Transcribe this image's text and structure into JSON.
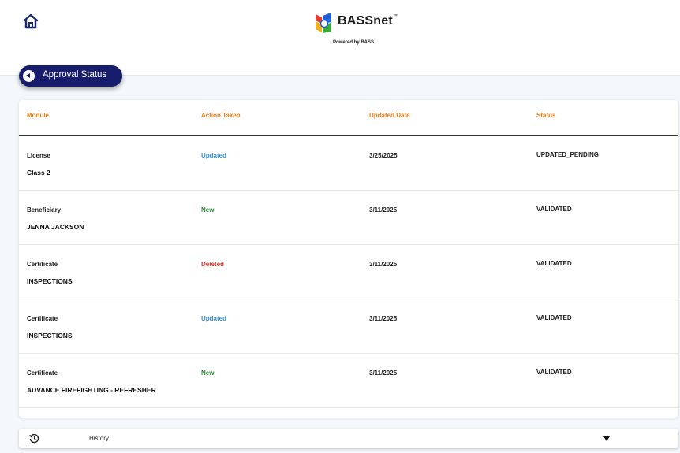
{
  "header": {
    "brand_name": "BASSnet",
    "brand_trademark": "™",
    "brand_tagline": "Powered by BASS",
    "home_icon": "home-icon"
  },
  "page": {
    "back_icon": "back-arrow-icon",
    "title": "Approval Status"
  },
  "table": {
    "columns": [
      "Module",
      "Action Taken",
      "Updated Date",
      "Status"
    ],
    "rows": [
      {
        "module": "License",
        "name": "Class 2",
        "action": "Updated",
        "date": "3/25/2025",
        "status": "UPDATED_PENDING"
      },
      {
        "module": "Beneficiary",
        "name": "JENNA JACKSON",
        "action": "New",
        "date": "3/11/2025",
        "status": "VALIDATED"
      },
      {
        "module": "Certificate",
        "name": "INSPECTIONS",
        "action": "Deleted",
        "date": "3/11/2025",
        "status": "VALIDATED"
      },
      {
        "module": "Certificate",
        "name": "INSPECTIONS",
        "action": "Updated",
        "date": "3/11/2025",
        "status": "VALIDATED"
      },
      {
        "module": "Certificate",
        "name": "ADVANCE FIREFIGHTING - REFRESHER",
        "action": "New",
        "date": "3/11/2025",
        "status": "VALIDATED"
      }
    ]
  },
  "history": {
    "icon": "history-icon",
    "label": "History",
    "expand_icon": "caret-down-icon"
  },
  "colors": {
    "header_text": "#e8801e",
    "action_updated": "#3a8fd6",
    "action_new": "#2e8b3a",
    "action_deleted": "#e0302a",
    "pill_bg": "#171c6b"
  }
}
